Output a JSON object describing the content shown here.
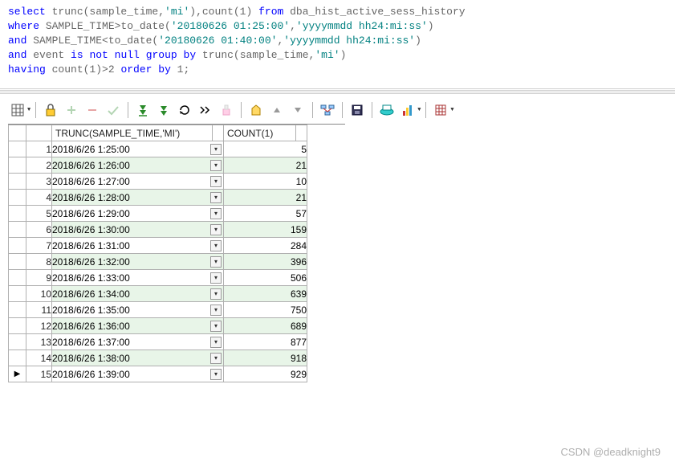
{
  "sql": {
    "line1_p1": "select",
    "line1_p2": " trunc(sample_time,",
    "line1_str1": "'mi'",
    "line1_p3": "),count(1) ",
    "line1_kw2": "from",
    "line1_p4": " dba_hist_active_sess_history",
    "line2_kw1": "where",
    "line2_p1": " SAMPLE_TIME>to_date(",
    "line2_str1": "'20180626 01:25:00'",
    "line2_p2": ",",
    "line2_str2": "'yyyymmdd hh24:mi:ss'",
    "line2_p3": ")",
    "line3_kw1": "and",
    "line3_p1": " SAMPLE_TIME<to_date(",
    "line3_str1": "'20180626 01:40:00'",
    "line3_p2": ",",
    "line3_str2": "'yyyymmdd hh24:mi:ss'",
    "line3_p3": ")",
    "line4_kw1": "and",
    "line4_p1": " event ",
    "line4_kw2": "is",
    "line4_p2": " ",
    "line4_kw3": "not",
    "line4_p3": " ",
    "line4_kw4": "null",
    "line4_p4": " ",
    "line4_kw5": "group",
    "line4_p5": " ",
    "line4_kw6": "by",
    "line4_p6": " trunc(sample_time,",
    "line4_str1": "'mi'",
    "line4_p7": ")",
    "line5_kw1": "having",
    "line5_p1": " count(1)>2 ",
    "line5_kw2": "order",
    "line5_p2": " ",
    "line5_kw3": "by",
    "line5_p3": " 1;"
  },
  "grid": {
    "headers": {
      "col1": "TRUNC(SAMPLE_TIME,'MI')",
      "col2": "COUNT(1)"
    },
    "rows": [
      {
        "n": "1",
        "t": "2018/6/26 1:25:00",
        "c": "5"
      },
      {
        "n": "2",
        "t": "2018/6/26 1:26:00",
        "c": "21"
      },
      {
        "n": "3",
        "t": "2018/6/26 1:27:00",
        "c": "10"
      },
      {
        "n": "4",
        "t": "2018/6/26 1:28:00",
        "c": "21"
      },
      {
        "n": "5",
        "t": "2018/6/26 1:29:00",
        "c": "57"
      },
      {
        "n": "6",
        "t": "2018/6/26 1:30:00",
        "c": "159"
      },
      {
        "n": "7",
        "t": "2018/6/26 1:31:00",
        "c": "284"
      },
      {
        "n": "8",
        "t": "2018/6/26 1:32:00",
        "c": "396"
      },
      {
        "n": "9",
        "t": "2018/6/26 1:33:00",
        "c": "506"
      },
      {
        "n": "10",
        "t": "2018/6/26 1:34:00",
        "c": "639"
      },
      {
        "n": "11",
        "t": "2018/6/26 1:35:00",
        "c": "750"
      },
      {
        "n": "12",
        "t": "2018/6/26 1:36:00",
        "c": "689"
      },
      {
        "n": "13",
        "t": "2018/6/26 1:37:00",
        "c": "877"
      },
      {
        "n": "14",
        "t": "2018/6/26 1:38:00",
        "c": "918"
      },
      {
        "n": "15",
        "t": "2018/6/26 1:39:00",
        "c": "929"
      }
    ],
    "current_row": 14
  },
  "watermark": "CSDN @deadknight9"
}
